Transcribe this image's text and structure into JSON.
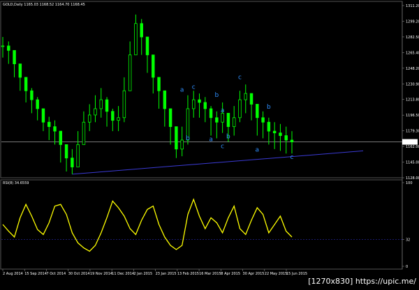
{
  "main_chart": {
    "header": "GOLD,Daily  1165.03  1168.52  1164.70  1168.45",
    "current_price_label": "1168.45",
    "price_labels": [
      "1311.20",
      "1299.20",
      "1282.50",
      "1265.40",
      "1248.20",
      "1230.90",
      "1213.80",
      "1196.50",
      "1179.30",
      "1162.00",
      "1145.00",
      "1128.00"
    ],
    "wave_labels": [
      {
        "text": "a",
        "x_index": 31,
        "price": 1224
      },
      {
        "text": "c",
        "x_index": 33,
        "price": 1227
      },
      {
        "text": "b",
        "x_index": 32,
        "price": 1170
      },
      {
        "text": "b",
        "x_index": 37,
        "price": 1218
      },
      {
        "text": "a",
        "x_index": 38,
        "price": 1201
      },
      {
        "text": "a",
        "x_index": 36,
        "price": 1169
      },
      {
        "text": "c",
        "x_index": 38,
        "price": 1161
      },
      {
        "text": "b",
        "x_index": 39,
        "price": 1172
      },
      {
        "text": "c",
        "x_index": 41,
        "price": 1238
      },
      {
        "text": "b",
        "x_index": 46,
        "price": 1205
      },
      {
        "text": "a",
        "x_index": 44,
        "price": 1157
      },
      {
        "text": "c",
        "x_index": 50,
        "price": 1149
      }
    ]
  },
  "rsi_panel": {
    "header": "RSI(8) 34.6559",
    "levels": [
      "100",
      "32",
      "0"
    ]
  },
  "date_axis": [
    "2 Aug 2014",
    "15 Sep 2014",
    "7 Oct 2014",
    "30 Oct 2014",
    "19 Nov 2014",
    "11 Dec 2014",
    "2 Jan 2015",
    "23 Jan 2015",
    "13 Feb 2015",
    "16 Mar 2015",
    "8 Apr 2015",
    "30 Apr 2015",
    "22 May 2015",
    "15 Jun 2015"
  ],
  "watermark": "[1270x830] https://upic.me/",
  "colors": {
    "background": "#000000",
    "bull": "#00ff00",
    "bear": "#00ff00",
    "rsi": "#ffff00",
    "trendline": "#3b3bd6",
    "wave": "#2f8fff",
    "current_line": "#c0c0c0",
    "level_line": "#2a2ab0"
  },
  "chart_data": [
    {
      "type": "candlestick",
      "title": "GOLD,Daily",
      "ylim": [
        1128,
        1320
      ],
      "x": [
        "Aug-2014",
        "Sep-2014",
        "Sep-2014",
        "Sep-2014",
        "Sep-2014",
        "Sep-2014",
        "Oct-2014",
        "Oct-2014",
        "Oct-2014",
        "Oct-2014",
        "Oct-2014",
        "Nov-2014",
        "Nov-2014",
        "Nov-2014",
        "Nov-2014",
        "Dec-2014",
        "Dec-2014",
        "Dec-2014",
        "Dec-2014",
        "Dec-2014",
        "Jan-2015",
        "Jan-2015",
        "Jan-2015",
        "Jan-2015",
        "Jan-2015",
        "Feb-2015",
        "Feb-2015",
        "Feb-2015",
        "Feb-2015",
        "Mar-2015",
        "Mar-2015",
        "Mar-2015",
        "Mar-2015",
        "Mar-2015",
        "Apr-2015",
        "Apr-2015",
        "Apr-2015",
        "Apr-2015",
        "Apr-2015",
        "Apr-2015",
        "May-2015",
        "May-2015",
        "May-2015",
        "May-2015",
        "May-2015",
        "Jun-2015",
        "Jun-2015",
        "Jun-2015",
        "Jun-2015",
        "Jun-2015",
        "Jun-2015"
      ],
      "close": [
        1275,
        1270,
        1255,
        1240,
        1225,
        1215,
        1205,
        1190,
        1185,
        1180,
        1165,
        1150,
        1140,
        1165,
        1190,
        1198,
        1205,
        1215,
        1202,
        1192,
        1195,
        1225,
        1265,
        1300,
        1285,
        1265,
        1240,
        1225,
        1205,
        1185,
        1160,
        1170,
        1205,
        1215,
        1212,
        1205,
        1195,
        1190,
        1200,
        1185,
        1195,
        1215,
        1222,
        1210,
        1195,
        1190,
        1180,
        1178,
        1175,
        1170,
        1168
      ],
      "high": [
        1285,
        1280,
        1270,
        1255,
        1240,
        1228,
        1218,
        1205,
        1196,
        1192,
        1180,
        1165,
        1160,
        1180,
        1202,
        1210,
        1220,
        1228,
        1218,
        1205,
        1208,
        1240,
        1280,
        1310,
        1305,
        1285,
        1258,
        1240,
        1222,
        1202,
        1180,
        1185,
        1220,
        1225,
        1222,
        1218,
        1208,
        1202,
        1212,
        1198,
        1208,
        1225,
        1232,
        1222,
        1208,
        1202,
        1195,
        1190,
        1188,
        1185,
        1180
      ],
      "low": [
        1262,
        1255,
        1240,
        1225,
        1212,
        1200,
        1192,
        1180,
        1170,
        1165,
        1145,
        1135,
        1132,
        1140,
        1165,
        1180,
        1190,
        1195,
        1185,
        1180,
        1180,
        1190,
        1230,
        1270,
        1265,
        1245,
        1222,
        1205,
        1185,
        1165,
        1150,
        1152,
        1165,
        1195,
        1195,
        1190,
        1175,
        1172,
        1178,
        1168,
        1175,
        1190,
        1200,
        1192,
        1175,
        1172,
        1165,
        1160,
        1158,
        1155,
        1155
      ]
    },
    {
      "type": "line",
      "title": "RSI(8) 34.6559",
      "ylim": [
        0,
        100
      ],
      "series": [
        {
          "name": "RSI(8)",
          "values": [
            50,
            42,
            35,
            58,
            74,
            60,
            44,
            38,
            52,
            72,
            74,
            62,
            40,
            28,
            22,
            18,
            25,
            40,
            58,
            78,
            70,
            60,
            45,
            38,
            55,
            68,
            72,
            50,
            35,
            25,
            20,
            25,
            62,
            80,
            60,
            45,
            58,
            52,
            40,
            58,
            72,
            45,
            38,
            55,
            70,
            62,
            40,
            50,
            60,
            42,
            35
          ]
        }
      ],
      "levels": [
        32
      ]
    }
  ]
}
